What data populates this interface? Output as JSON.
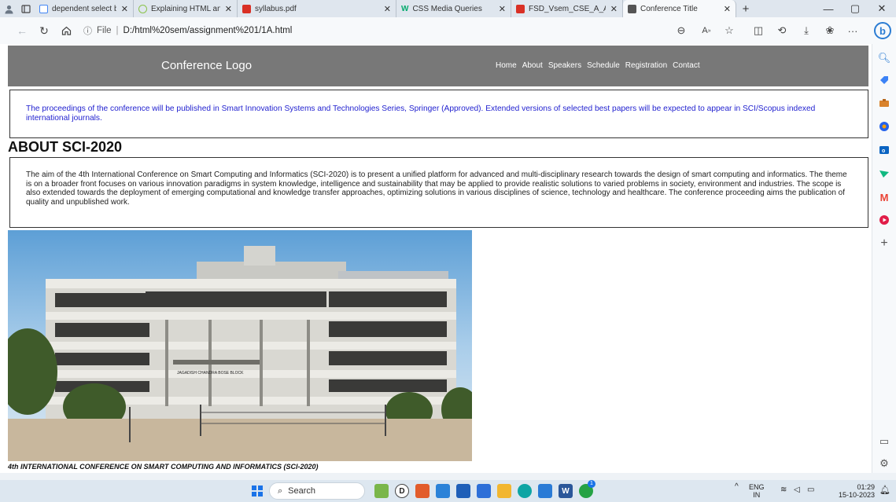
{
  "browser": {
    "tabs": [
      {
        "label": "dependent select box usin",
        "favicon_color": "#4285f4"
      },
      {
        "label": "Explaining HTML and Java",
        "favicon_color": "#8bc34a"
      },
      {
        "label": "syllabus.pdf",
        "favicon_color": "#d93025"
      },
      {
        "label": "CSS Media Queries",
        "favicon_color": "#04aa6d"
      },
      {
        "label": "FSD_Vsem_CSE_A_Assignm",
        "favicon_color": "#d93025"
      },
      {
        "label": "Conference Title",
        "favicon_color": "#555555",
        "active": true
      }
    ],
    "address": {
      "protocol": "File",
      "url": "D:/html%20sem/assignment%201/1A.html"
    }
  },
  "site": {
    "logo": "Conference Logo",
    "nav": [
      "Home",
      "About",
      "Speakers",
      "Schedule",
      "Registration",
      "Contact"
    ],
    "notice": "The proceedings of the conference will be published in Smart Innovation Systems and Technologies Series, Springer (Approved). Extended versions of selected best papers will be expected to appear in SCI/Scopus indexed international journals.",
    "about_heading": "ABOUT SCI-2020",
    "about_text": "The aim of the 4th International Conference on Smart Computing and Informatics (SCI-2020) is to present a unified platform for advanced and multi-disciplinary research towards the design of smart computing and informatics. The theme is on a broader front focuses on various innovation paradigms in system knowledge, intelligence and sustainability that may be applied to provide realistic solutions to varied problems in society, environment and industries. The scope is also extended towards the deployment of emerging computational and knowledge transfer approaches, optimizing solutions in various disciplines of science, technology and healthcare. The conference proceeding aims the publication of quality and unpublished work.",
    "caption": "4th INTERNATIONAL CONFERENCE ON SMART COMPUTING AND INFORMATICS (SCI-2020)",
    "building_sign": "JAGADISH CHANDRA BOSE BLOCK"
  },
  "taskbar": {
    "search_placeholder": "Search",
    "lang_top": "ENG",
    "lang_bottom": "IN",
    "time": "01:29",
    "date": "15-10-2023",
    "notification_count": "1"
  },
  "colors": {
    "header_bg": "#787878",
    "notice_text": "#1f1fcf",
    "accent": "#1a73e8"
  }
}
